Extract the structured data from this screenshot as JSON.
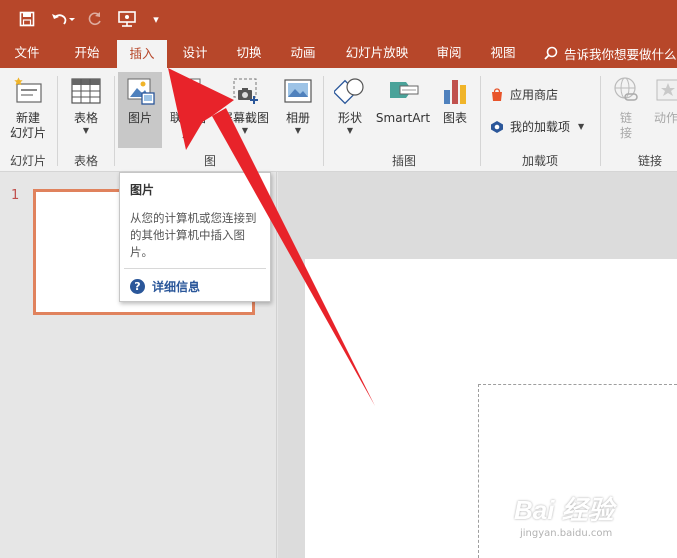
{
  "quick_access": {
    "save": "save-icon",
    "undo": "undo-icon",
    "redo": "redo-icon",
    "start_presentation": "present-icon",
    "customize": "▾"
  },
  "tabs": [
    {
      "label": "文件"
    },
    {
      "label": "开始"
    },
    {
      "label": "插入"
    },
    {
      "label": "设计"
    },
    {
      "label": "切换"
    },
    {
      "label": "动画"
    },
    {
      "label": "幻灯片放映"
    },
    {
      "label": "审阅"
    },
    {
      "label": "视图"
    }
  ],
  "tell_me": "告诉我你想要做什么",
  "ribbon": {
    "new_slide_line1": "新建",
    "new_slide_line2": "幻灯片",
    "table": "表格",
    "picture": "图片",
    "online_pictures": "联机图片",
    "screenshot": "屏幕截图",
    "album": "相册",
    "shapes": "形状",
    "smartart": "SmartArt",
    "chart": "图表",
    "store": "应用商店",
    "my_addins": "我的加载项",
    "link_line1": "链",
    "link_line2": "接",
    "action": "动作",
    "groups": {
      "slides": "幻灯片",
      "tables": "表格",
      "images": "图",
      "illustrations": "插图",
      "addins": "加载项",
      "links": "链接"
    }
  },
  "tooltip": {
    "title": "图片",
    "description": "从您的计算机或您连接到的其他计算机中插入图片。",
    "more_info": "详细信息"
  },
  "slide_pane": {
    "slide_number": "1"
  },
  "watermark": {
    "brand": "Bai 经验",
    "url": "jingyan.baidu.com"
  },
  "colors": {
    "accent": "#b7472a",
    "annotation_arrow": "#e8232a",
    "thumbnail_border": "#e0825d",
    "link_blue": "#2b579a"
  }
}
